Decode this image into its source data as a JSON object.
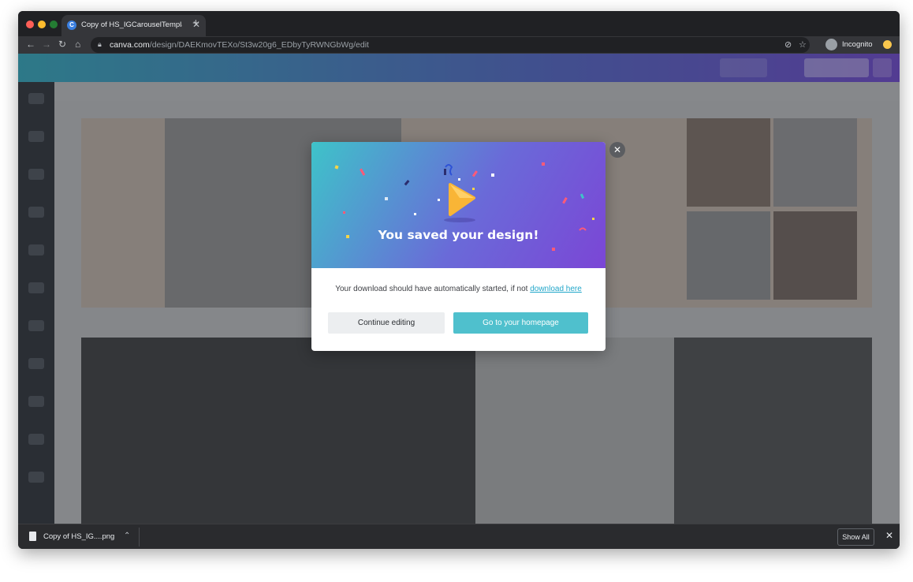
{
  "browser": {
    "tab_title": "Copy of HS_IGCarouselTempla",
    "tab_favicon_letter": "C",
    "url_host": "canva.com",
    "url_path": "/design/DAEKmovTEXo/St3w20g6_EDbyTyRWNGbWg/edit",
    "profile_label": "Incognito"
  },
  "modal": {
    "title": "You saved your design!",
    "message_prefix": "Your download should have automatically started, if not ",
    "download_link": "download here",
    "continue_button": "Continue editing",
    "home_button": "Go to your homepage",
    "close_glyph": "✕"
  },
  "download_shelf": {
    "file_name": "Copy of HS_IG....png",
    "show_all": "Show All",
    "close_glyph": "✕"
  },
  "colors": {
    "hero_start": "#3ec3c9",
    "hero_end": "#7b46d6",
    "primary_button": "#4fc0cd",
    "link": "#21a6c9"
  },
  "icons": [
    "back-icon",
    "forward-icon",
    "reload-icon",
    "home-icon",
    "lock-icon",
    "eye-off-icon",
    "star-icon",
    "file-icon",
    "chevron-up-icon",
    "close-icon"
  ]
}
